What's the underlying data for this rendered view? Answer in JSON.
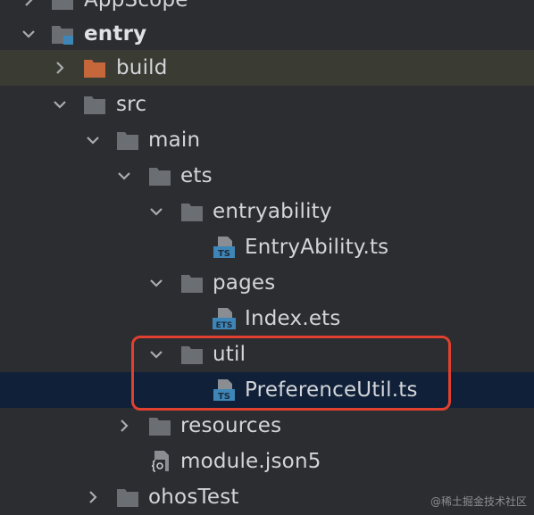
{
  "tree": {
    "appscope_label": "AppScope",
    "entry_label": "entry",
    "build_label": "build",
    "src_label": "src",
    "main_label": "main",
    "ets_label": "ets",
    "entryability_label": "entryability",
    "entryability_file": "EntryAbility.ts",
    "pages_label": "pages",
    "index_file": "Index.ets",
    "util_label": "util",
    "preferenceutil_file": "PreferenceUtil.ts",
    "resources_label": "resources",
    "module_file": "module.json5",
    "ohostest_label": "ohosTest"
  },
  "icons": {
    "ts_badge": "TS",
    "ets_badge": "ETS"
  },
  "colors": {
    "background": "#2b2d30",
    "selected_row": "#0f2038",
    "build_row": "#3a3b32",
    "folder": "#6b6e73",
    "build_folder": "#c5673a",
    "badge_blue": "#3f86b8",
    "highlight": "#e0402f"
  },
  "watermark": "@稀土掘金技术社区"
}
